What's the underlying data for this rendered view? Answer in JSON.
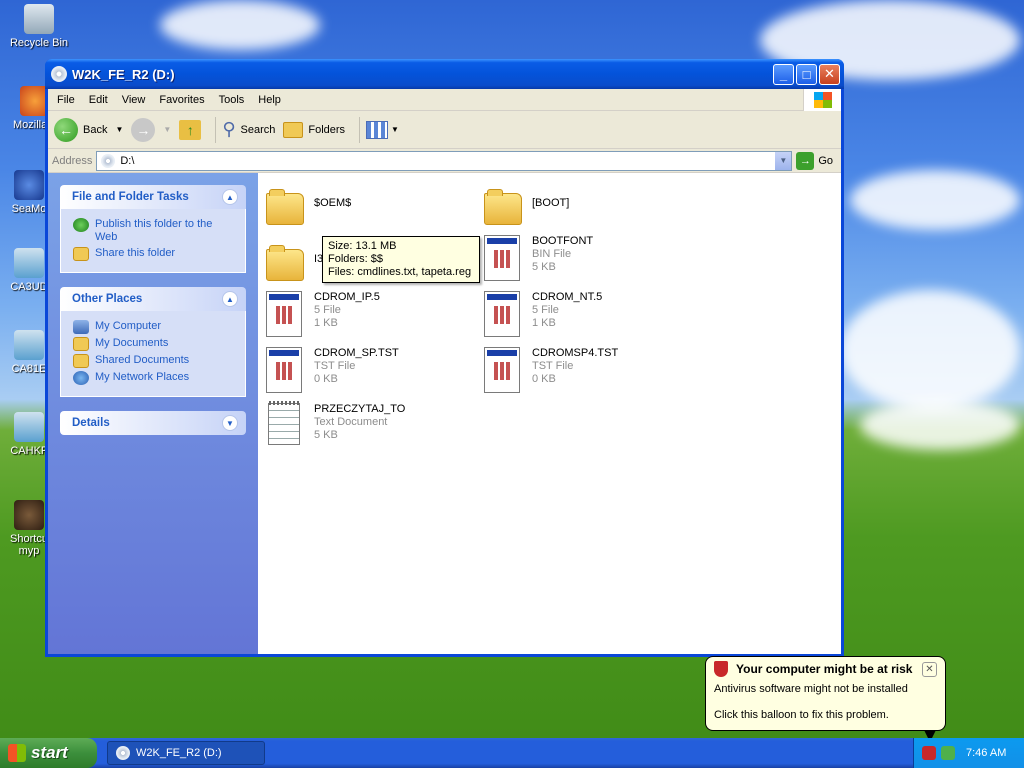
{
  "desktop": {
    "icons": [
      {
        "label": "Recycle Bin",
        "icon": "recycle-bin-icon"
      },
      {
        "label": "Mozilla F",
        "icon": "firefox-icon"
      },
      {
        "label": "SeaMo",
        "icon": "seamonkey-icon"
      },
      {
        "label": "CA3UD",
        "icon": "ca-icon"
      },
      {
        "label": "CA81E",
        "icon": "ca-icon"
      },
      {
        "label": "CAHKF",
        "icon": "ca-icon"
      },
      {
        "label": "Shortcu",
        "label2": "myp",
        "icon": "shortcut-icon"
      }
    ]
  },
  "window": {
    "title": "W2K_FE_R2 (D:)",
    "menu": [
      "File",
      "Edit",
      "View",
      "Favorites",
      "Tools",
      "Help"
    ],
    "toolbar": {
      "back": "Back",
      "search": "Search",
      "folders": "Folders"
    },
    "address": {
      "label": "Address",
      "value": "D:\\",
      "go": "Go"
    },
    "tasks": {
      "file_folder": {
        "title": "File and Folder Tasks",
        "items": [
          "Publish this folder to the Web",
          "Share this folder"
        ]
      },
      "other_places": {
        "title": "Other Places",
        "items": [
          "My Computer",
          "My Documents",
          "Shared Documents",
          "My Network Places"
        ]
      },
      "details": {
        "title": "Details"
      }
    },
    "files": [
      {
        "name": "$OEM$",
        "type": "",
        "size": "",
        "kind": "folder"
      },
      {
        "name": "[BOOT]",
        "type": "",
        "size": "",
        "kind": "folder"
      },
      {
        "name": "I3",
        "type": "",
        "size": "",
        "kind": "folder"
      },
      {
        "name": "BOOTFONT",
        "type": "BIN File",
        "size": "5 KB",
        "kind": "doc"
      },
      {
        "name": "CDROM_IP.5",
        "type": "5 File",
        "size": "1 KB",
        "kind": "doc"
      },
      {
        "name": "CDROM_NT.5",
        "type": "5 File",
        "size": "1 KB",
        "kind": "doc"
      },
      {
        "name": "CDROM_SP.TST",
        "type": "TST File",
        "size": "0 KB",
        "kind": "doc"
      },
      {
        "name": "CDROMSP4.TST",
        "type": "TST File",
        "size": "0 KB",
        "kind": "doc"
      },
      {
        "name": "PRZECZYTAJ_TO",
        "type": "Text Document",
        "size": "5 KB",
        "kind": "txt"
      }
    ],
    "tooltip": {
      "size": "Size: 13.1 MB",
      "folders": "Folders: $$",
      "files": "Files: cmdlines.txt, tapeta.reg"
    }
  },
  "taskbar": {
    "start": "start",
    "task": "W2K_FE_R2 (D:)",
    "clock": "7:46 AM"
  },
  "balloon": {
    "title": "Your computer might be at risk",
    "line1": "Antivirus software might not be installed",
    "line2": "Click this balloon to fix this problem."
  },
  "colors": {
    "accent": "#0a47d8",
    "link": "#215dc6",
    "tooltip_bg": "#ffffe1"
  }
}
